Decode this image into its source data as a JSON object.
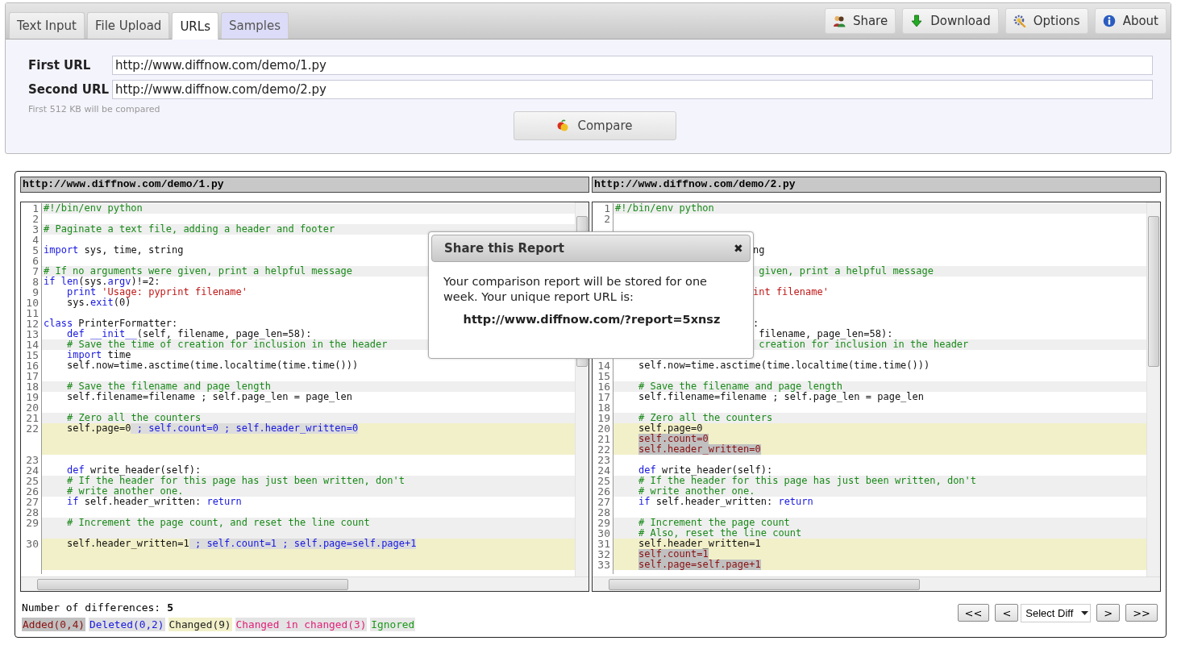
{
  "tabs": [
    {
      "label": "Text Input",
      "selected": false,
      "kind": "plain"
    },
    {
      "label": "File Upload",
      "selected": false,
      "kind": "plain"
    },
    {
      "label": "URLs",
      "selected": true,
      "kind": "plain"
    },
    {
      "label": "Samples",
      "selected": false,
      "kind": "samples"
    }
  ],
  "toolbar": [
    {
      "label": "Share",
      "kind": "share"
    },
    {
      "label": "Download",
      "kind": "download"
    },
    {
      "label": "Options",
      "kind": "options"
    },
    {
      "label": "About",
      "kind": "about"
    }
  ],
  "form": {
    "fields": [
      {
        "label": "First URL",
        "value": "http://www.diffnow.com/demo/1.py"
      },
      {
        "label": "Second URL",
        "value": "http://www.diffnow.com/demo/2.py"
      }
    ],
    "note": "First 512 KB will be compared",
    "button": "Compare"
  },
  "panes": [
    {
      "title": "http://www.diffnow.com/demo/1.py",
      "rows": [
        {
          "n": "1",
          "kind": "comment",
          "seg": [
            {
              "t": "#!/bin/env python",
              "kind": "comment"
            }
          ]
        },
        {
          "n": "2",
          "kind": "plain"
        },
        {
          "n": "3",
          "kind": "comment",
          "seg": [
            {
              "t": "# Paginate a text file, adding a header and footer",
              "kind": "comment"
            }
          ]
        },
        {
          "n": "4",
          "kind": "plain"
        },
        {
          "n": "5",
          "kind": "plain",
          "seg": [
            {
              "t": "import",
              "kind": "keyword"
            },
            {
              "t": " sys, time, string",
              "kind": "plain"
            }
          ]
        },
        {
          "n": "6",
          "kind": "plain"
        },
        {
          "n": "7",
          "kind": "comment",
          "seg": [
            {
              "t": "# If no arguments were given, print a helpful message",
              "kind": "comment"
            }
          ]
        },
        {
          "n": "8",
          "kind": "plain",
          "seg": [
            {
              "t": "if len",
              "kind": "keyword"
            },
            {
              "t": "(sys.",
              "kind": "plain"
            },
            {
              "t": "argv",
              "kind": "keyword"
            },
            {
              "t": ")!=2:",
              "kind": "plain"
            }
          ]
        },
        {
          "n": "9",
          "kind": "plain",
          "indent": true,
          "seg": [
            {
              "t": "print ",
              "kind": "keyword"
            },
            {
              "t": "'Usage: pyprint filename'",
              "kind": "string"
            }
          ]
        },
        {
          "n": "10",
          "kind": "plain",
          "indent": true,
          "seg": [
            {
              "t": "sys.",
              "kind": "plain"
            },
            {
              "t": "exit",
              "kind": "keyword"
            },
            {
              "t": "(0)",
              "kind": "plain"
            }
          ]
        },
        {
          "n": "11",
          "kind": "plain"
        },
        {
          "n": "12",
          "kind": "plain",
          "seg": [
            {
              "t": "class",
              "kind": "keyword"
            },
            {
              "t": " PrinterFormatter:",
              "kind": "plain"
            }
          ]
        },
        {
          "n": "13",
          "kind": "plain",
          "indent": true,
          "seg": [
            {
              "t": "def __init__",
              "kind": "keyword"
            },
            {
              "t": "(self, filename, page_len=58):",
              "kind": "plain"
            }
          ]
        },
        {
          "n": "14",
          "kind": "comment",
          "indent": true,
          "seg": [
            {
              "t": "# Save the time of creation for inclusion in the header",
              "kind": "comment"
            }
          ]
        },
        {
          "n": "15",
          "kind": "plain",
          "indent": true,
          "seg": [
            {
              "t": "import",
              "kind": "keyword"
            },
            {
              "t": " time",
              "kind": "plain"
            }
          ]
        },
        {
          "n": "16",
          "kind": "plain",
          "indent": true,
          "seg": [
            {
              "t": "self.now=time.asctime(time.localtime(time.time()))",
              "kind": "plain"
            }
          ]
        },
        {
          "n": "17",
          "kind": "plain"
        },
        {
          "n": "18",
          "kind": "comment",
          "indent": true,
          "seg": [
            {
              "t": "# Save the filename and page length",
              "kind": "comment"
            }
          ]
        },
        {
          "n": "19",
          "kind": "plain",
          "indent": true,
          "seg": [
            {
              "t": "self.filename=filename ; self.page_len = page_len",
              "kind": "plain"
            }
          ]
        },
        {
          "n": "20",
          "kind": "plain"
        },
        {
          "n": "21",
          "kind": "comment",
          "indent": true,
          "seg": [
            {
              "t": "# Zero all the counters",
              "kind": "comment"
            }
          ]
        },
        {
          "n": "22",
          "kind": "changed-block",
          "indent": true,
          "seg": [
            {
              "t": "self.page=0",
              "kind": "plain"
            },
            {
              "t": " ; self.count=0 ; self.header_written=0",
              "kind": "deleted"
            }
          ]
        },
        {
          "n": "23",
          "kind": "plain"
        },
        {
          "n": "24",
          "kind": "plain",
          "indent": true,
          "seg": [
            {
              "t": "def",
              "kind": "keyword"
            },
            {
              "t": " write_header(self):",
              "kind": "plain"
            }
          ]
        },
        {
          "n": "25",
          "kind": "comment",
          "indent": true,
          "seg": [
            {
              "t": "# If the header for this page has just been written, don't",
              "kind": "comment"
            }
          ]
        },
        {
          "n": "26",
          "kind": "comment",
          "indent": true,
          "seg": [
            {
              "t": "# write another one.",
              "kind": "comment"
            }
          ]
        },
        {
          "n": "27",
          "kind": "plain",
          "indent": true,
          "seg": [
            {
              "t": "if",
              "kind": "keyword"
            },
            {
              "t": " self.header_written: ",
              "kind": "plain"
            },
            {
              "t": "return",
              "kind": "keyword"
            }
          ]
        },
        {
          "n": "28",
          "kind": "plain"
        },
        {
          "n": "29",
          "kind": "comment",
          "indent": true,
          "seg": [
            {
              "t": "# Increment the page count, and reset the line count",
              "kind": "comment"
            }
          ]
        },
        {
          "kind": "comment"
        },
        {
          "n": "30",
          "kind": "changed-block",
          "indent": true,
          "seg": [
            {
              "t": "self.header_written=1",
              "kind": "plain"
            },
            {
              "t": " ; self.count=1 ; self.page=self.page+1",
              "kind": "deleted"
            }
          ]
        }
      ]
    },
    {
      "title": "http://www.diffnow.com/demo/2.py",
      "rows": [
        {
          "n": "1",
          "kind": "comment",
          "seg": [
            {
              "t": "#!/bin/env python",
              "kind": "comment"
            }
          ]
        },
        {
          "n": "2",
          "kind": "plain"
        },
        {
          "kind": "plain"
        },
        {
          "kind": "plain"
        },
        {
          "kind": "plain",
          "hidden_start": true,
          "seg": [
            {
              "t": "ng",
              "kind": "plain"
            }
          ]
        },
        {
          "kind": "plain"
        },
        {
          "kind": "comment",
          "hidden_start": true,
          "seg": [
            {
              "t": " given, print a helpful message",
              "kind": "comment"
            }
          ]
        },
        {
          "kind": "plain"
        },
        {
          "kind": "plain",
          "hidden_start": true,
          "seg": [
            {
              "t": "int filename'",
              "kind": "string"
            }
          ]
        },
        {
          "kind": "plain"
        },
        {
          "kind": "plain"
        },
        {
          "kind": "plain",
          "hidden_start": true,
          "seg": [
            {
              "t": ":",
              "kind": "plain"
            }
          ]
        },
        {
          "kind": "plain",
          "hidden_start": true,
          "seg": [
            {
              "t": " filename, page_len=58):",
              "kind": "plain"
            }
          ]
        },
        {
          "kind": "comment",
          "hidden_start": true,
          "seg": [
            {
              "t": " creation for inclusion in the header",
              "kind": "comment"
            }
          ]
        },
        {
          "kind": "plain"
        },
        {
          "n": "14",
          "kind": "plain",
          "indent": true,
          "seg": [
            {
              "t": "self.now=time.asctime(time.localtime(time.time()))",
              "kind": "plain"
            }
          ]
        },
        {
          "n": "15",
          "kind": "plain"
        },
        {
          "n": "16",
          "kind": "comment",
          "indent": true,
          "seg": [
            {
              "t": "# Save the filename and page length",
              "kind": "comment"
            }
          ]
        },
        {
          "n": "17",
          "kind": "plain",
          "indent": true,
          "seg": [
            {
              "t": "self.filename=filename ; self.page_len = page_len",
              "kind": "plain"
            }
          ]
        },
        {
          "n": "18",
          "kind": "plain"
        },
        {
          "n": "19",
          "kind": "comment",
          "indent": true,
          "seg": [
            {
              "t": "# Zero all the counters",
              "kind": "comment"
            }
          ]
        },
        {
          "n": "20",
          "kind": "changed",
          "indent": true,
          "seg": [
            {
              "t": "self.page=0",
              "kind": "plain"
            }
          ]
        },
        {
          "n": "21",
          "kind": "changed",
          "indent": true,
          "seg": [
            {
              "t": "self.count=0",
              "kind": "added"
            }
          ]
        },
        {
          "n": "22",
          "kind": "changed",
          "indent": true,
          "seg": [
            {
              "t": "self.header_written=0",
              "kind": "added"
            }
          ]
        },
        {
          "n": "23",
          "kind": "plain"
        },
        {
          "n": "24",
          "kind": "plain",
          "indent": true,
          "seg": [
            {
              "t": "def",
              "kind": "keyword"
            },
            {
              "t": " write_header(self):",
              "kind": "plain"
            }
          ]
        },
        {
          "n": "25",
          "kind": "comment",
          "indent": true,
          "seg": [
            {
              "t": "# If the header for this page has just been written, don't",
              "kind": "comment"
            }
          ]
        },
        {
          "n": "26",
          "kind": "comment",
          "indent": true,
          "seg": [
            {
              "t": "# write another one.",
              "kind": "comment"
            }
          ]
        },
        {
          "n": "27",
          "kind": "plain",
          "indent": true,
          "seg": [
            {
              "t": "if",
              "kind": "keyword"
            },
            {
              "t": " self.header_written: ",
              "kind": "plain"
            },
            {
              "t": "return",
              "kind": "keyword"
            }
          ]
        },
        {
          "n": "28",
          "kind": "plain"
        },
        {
          "n": "29",
          "kind": "comment",
          "indent": true,
          "seg": [
            {
              "t": "# Increment the page count",
              "kind": "comment"
            }
          ]
        },
        {
          "n": "30",
          "kind": "comment",
          "indent": true,
          "seg": [
            {
              "t": "# Also, reset the line count",
              "kind": "comment"
            }
          ]
        },
        {
          "n": "31",
          "kind": "changed",
          "indent": true,
          "seg": [
            {
              "t": "self.header_written=1",
              "kind": "plain"
            }
          ]
        },
        {
          "n": "32",
          "kind": "changed",
          "indent": true,
          "seg": [
            {
              "t": "self.count=1",
              "kind": "added"
            }
          ]
        },
        {
          "n": "33",
          "kind": "changed",
          "indent": true,
          "seg": [
            {
              "t": "self.page=self.page+1",
              "kind": "added"
            }
          ]
        }
      ]
    }
  ],
  "summary": {
    "label": "Number of differences:",
    "count": "5"
  },
  "legend": [
    {
      "label": "Added(0,4)",
      "kind": "added"
    },
    {
      "label": "Deleted(0,2)",
      "kind": "deleted"
    },
    {
      "label": "Changed(9)",
      "kind": "changed"
    },
    {
      "label": "Changed in changed(3)",
      "kind": "changed-in-changed"
    },
    {
      "label": "Ignored",
      "kind": "ignored"
    }
  ],
  "navigation": {
    "first": "<<",
    "previous": "<",
    "select": "Select Diff",
    "next": ">",
    "last": ">>"
  },
  "dialog": {
    "title": "Share this Report",
    "close": "✖",
    "message": "Your comparison report will be stored for one week. Your unique report URL is:",
    "url": "http://www.diffnow.com/?report=5xnsz"
  }
}
